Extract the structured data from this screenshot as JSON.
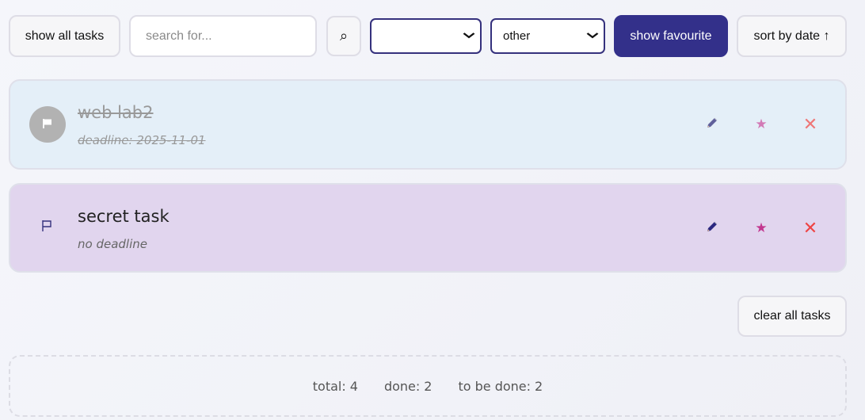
{
  "toolbar": {
    "show_all_label": "show all tasks",
    "search_placeholder": "search for...",
    "search_icon": "⌕",
    "filter_select_value": "",
    "category_select_value": "other",
    "show_favourite_label": "show favourite",
    "sort_label": "sort by date ↑",
    "accent_color": "#33308a"
  },
  "tasks": [
    {
      "title": "web lab2",
      "deadline": "deadline: 2025-11-01",
      "done": true,
      "flag_icon": "flag-filled-icon",
      "background": "#e4eff8"
    },
    {
      "title": "secret task",
      "deadline": "no deadline",
      "done": false,
      "flag_icon": "flag-outline-icon",
      "background": "#e1d5ee"
    }
  ],
  "actions": {
    "star_glyph": "★",
    "delete_glyph": "✕"
  },
  "footer": {
    "clear_label": "clear all tasks",
    "total_label": "total:",
    "total_value": "4",
    "done_label": "done:",
    "done_value": "2",
    "todo_label": "to be done:",
    "todo_value": "2"
  }
}
